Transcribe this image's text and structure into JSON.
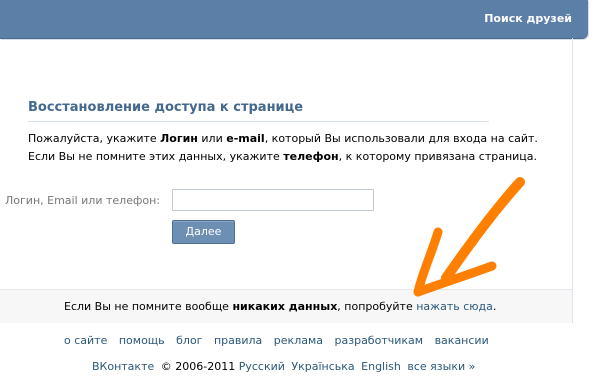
{
  "header": {
    "friends_search_link": "Поиск друзей"
  },
  "recovery": {
    "title": "Восстановление доступа к странице",
    "line1": {
      "t1": "Пожалуйста, укажите ",
      "b1": "Логин",
      "t2": " или ",
      "b2": "e-mail",
      "t3": ", который Вы использовали для входа на сайт."
    },
    "line2": {
      "t1": "Если Вы не помните этих данных, укажите ",
      "b1": "телефон",
      "t2": ", к которому привязана страница."
    },
    "field_label": "Логин, Email или телефон:",
    "field_value": "",
    "next_button": "Далее"
  },
  "bottom": {
    "t1": "Если Вы не помните вообще ",
    "b1": "никаких данных",
    "t2": ", попробуйте ",
    "link": "нажать сюда",
    "t3": "."
  },
  "footer": {
    "nav": [
      "о сайте",
      "помощь",
      "блог",
      "правила",
      "реклама",
      "разработчикам",
      "вакансии"
    ],
    "brand": "ВКонтакте",
    "copyright": "© 2006-2011",
    "languages": [
      "Русский",
      "Українська",
      "English",
      "все языки »"
    ]
  },
  "colors": {
    "header_bg": "#5b7fa6",
    "title": "#45688e",
    "link": "#2b587a",
    "button_bg": "#6d8fb3",
    "arrow": "#ff7f00"
  },
  "icons": {
    "annotation_arrow": "orange-arrow-icon"
  }
}
